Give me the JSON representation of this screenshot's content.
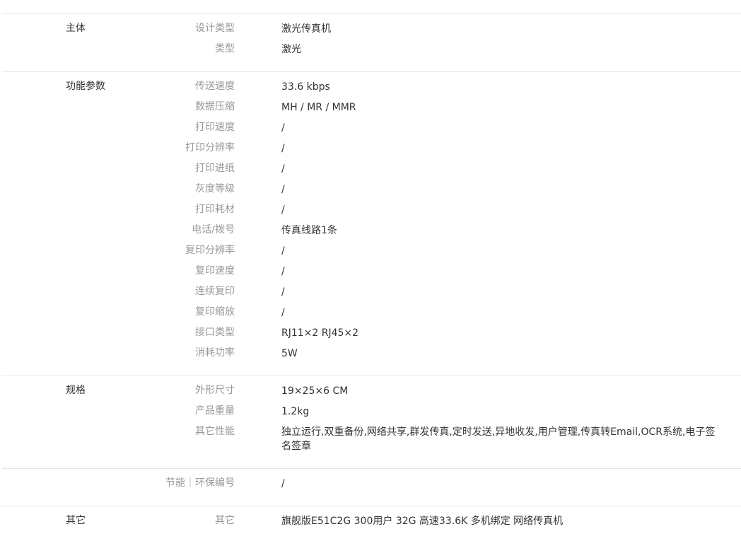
{
  "groups": [
    {
      "title": "主体",
      "rows": [
        {
          "label": "设计类型",
          "value": "激光传真机"
        },
        {
          "label": "类型",
          "value": "激光"
        }
      ]
    },
    {
      "title": "功能参数",
      "rows": [
        {
          "label": "传送速度",
          "value": "33.6 kbps"
        },
        {
          "label": "数据压缩",
          "value": "MH / MR / MMR"
        },
        {
          "label": "打印速度",
          "value": "/"
        },
        {
          "label": "打印分辨率",
          "value": "/"
        },
        {
          "label": "打印进纸",
          "value": "/"
        },
        {
          "label": "灰度等级",
          "value": "/"
        },
        {
          "label": "打印耗材",
          "value": "/"
        },
        {
          "label": "电话/拨号",
          "value": "传真线路1条"
        },
        {
          "label": "复印分辨率",
          "value": "/"
        },
        {
          "label": "复印速度",
          "value": "/"
        },
        {
          "label": "连续复印",
          "value": "/"
        },
        {
          "label": "复印缩放",
          "value": "/"
        },
        {
          "label": "接口类型",
          "value": "RJ11×2 RJ45×2"
        },
        {
          "label": "消耗功率",
          "value": "5W"
        }
      ]
    },
    {
      "title": "规格",
      "rows": [
        {
          "label": "外形尺寸",
          "value": "19×25×6 CM"
        },
        {
          "label": "产品重量",
          "value": "1.2kg"
        },
        {
          "label": "其它性能",
          "value": "独立运行,双重备份,网络共享,群发传真,定时发送,异地收发,用户管理,传真转Email,OCR系统,电子签名签章"
        }
      ]
    },
    {
      "title": "",
      "rows": [
        {
          "label": "节能｜环保编号",
          "value": "/"
        }
      ]
    },
    {
      "title": "其它",
      "rows": [
        {
          "label": "其它",
          "value": "旗舰版E51C2G 300用户 32G 高速33.6K 多机绑定 网络传真机"
        }
      ]
    }
  ]
}
